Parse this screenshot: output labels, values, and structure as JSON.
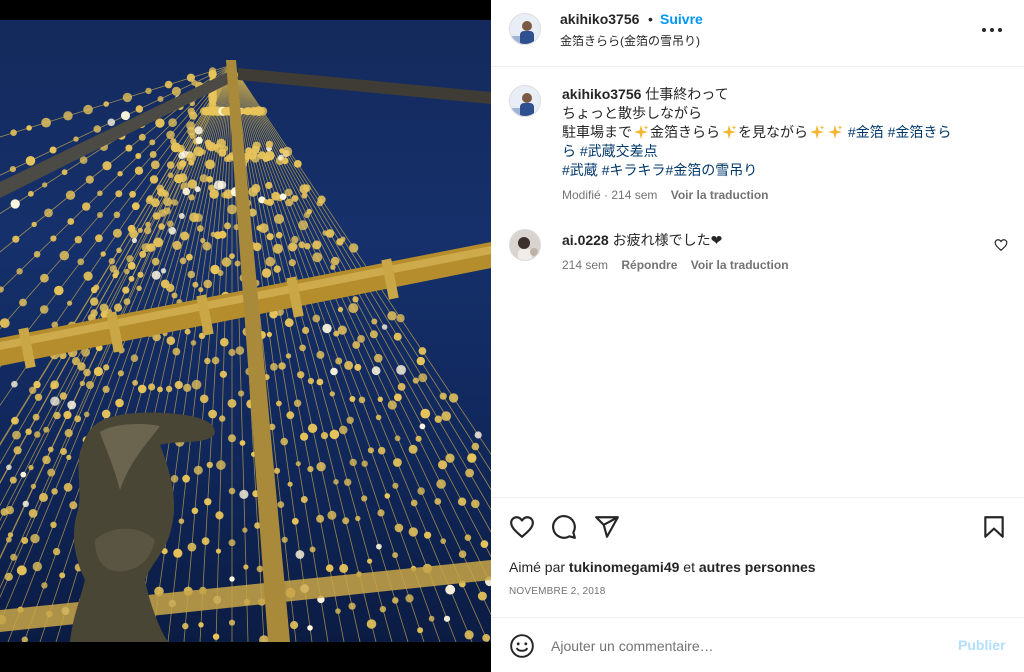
{
  "post": {
    "author": "akihiko3756",
    "dot": "•",
    "follow_label": "Suivre",
    "location": "金箔きらら(金箔の雪吊り)",
    "caption": {
      "line1_text": "仕事終わって",
      "line2": "ちょっと散歩しながら",
      "line3_a": "駐車場まで",
      "line3_b": "金箔きらら",
      "line3_c": "を見ながら",
      "tag1": "#金箔",
      "tag2": "#金箔きら",
      "tag2b": "ら",
      "tag3": "#武蔵交差点",
      "tag4": "#武蔵",
      "tag5": "#キラキラ",
      "tag6": "#金箔の雪吊り"
    },
    "caption_meta": {
      "edited": "Modifié · 214 sem",
      "translate": "Voir la traduction"
    },
    "comment": {
      "user": "ai.0228",
      "text": "お疲れ様でした❤",
      "age": "214 sem",
      "reply": "Répondre",
      "translate": "Voir la traduction"
    },
    "likes": {
      "prefix": "Aimé par",
      "user": "tukinomegami49",
      "suffix": "et",
      "others": "autres personnes"
    },
    "date": "NOVEMBRE 2, 2018"
  },
  "composer": {
    "placeholder": "Ajouter un commentaire…",
    "publish": "Publier"
  },
  "icons": {
    "more": "more-options-icon",
    "like": "heart-icon",
    "comment": "comment-icon",
    "share": "paper-plane-icon",
    "save": "bookmark-icon",
    "emoji": "emoji-icon",
    "sparkle": "sparkles-emoji"
  },
  "colors": {
    "accent": "#0095f6",
    "hashtag": "#00376b",
    "muted": "#737373",
    "publish_disabled": "#b2dffc",
    "sky": "#142a5c",
    "gold": "#e8c45a"
  }
}
